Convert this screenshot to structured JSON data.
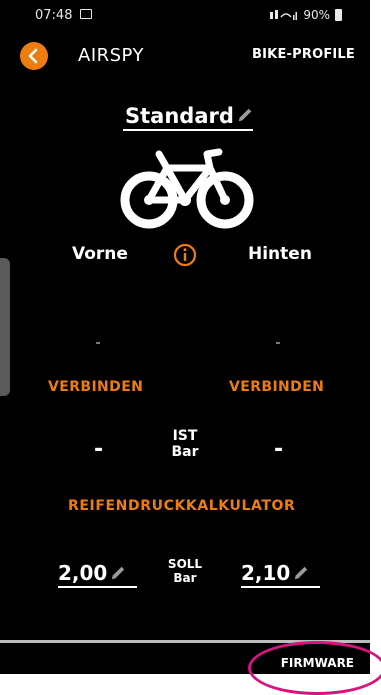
{
  "status_bar": {
    "time": "07:48",
    "battery": "90%"
  },
  "header": {
    "title": "AIRSPY",
    "bike_profile_label": "BIKE-PROFILE"
  },
  "profile": {
    "name": "Standard"
  },
  "labels": {
    "front": "Vorne",
    "rear": "Hinten"
  },
  "sensors": {
    "front": {
      "status": "-",
      "connect_label": "VERBINDEN",
      "ist_value": "-",
      "soll_value": "2,00"
    },
    "rear": {
      "status": "-",
      "connect_label": "VERBINDEN",
      "ist_value": "-",
      "soll_value": "2,10"
    }
  },
  "ist": {
    "label": "IST",
    "unit": "Bar"
  },
  "soll": {
    "label": "SOLL",
    "unit": "Bar"
  },
  "calculator_label": "REIFENDRUCKKALKULATOR",
  "footer": {
    "firmware_label": "FIRMWARE"
  },
  "colors": {
    "accent": "#ee7d11",
    "background": "#000000",
    "highlight": "#d4147f"
  },
  "icons": [
    "back-arrow-icon",
    "pencil-icon",
    "bike-icon",
    "info-icon",
    "image-icon",
    "signal-icon",
    "battery-icon"
  ]
}
